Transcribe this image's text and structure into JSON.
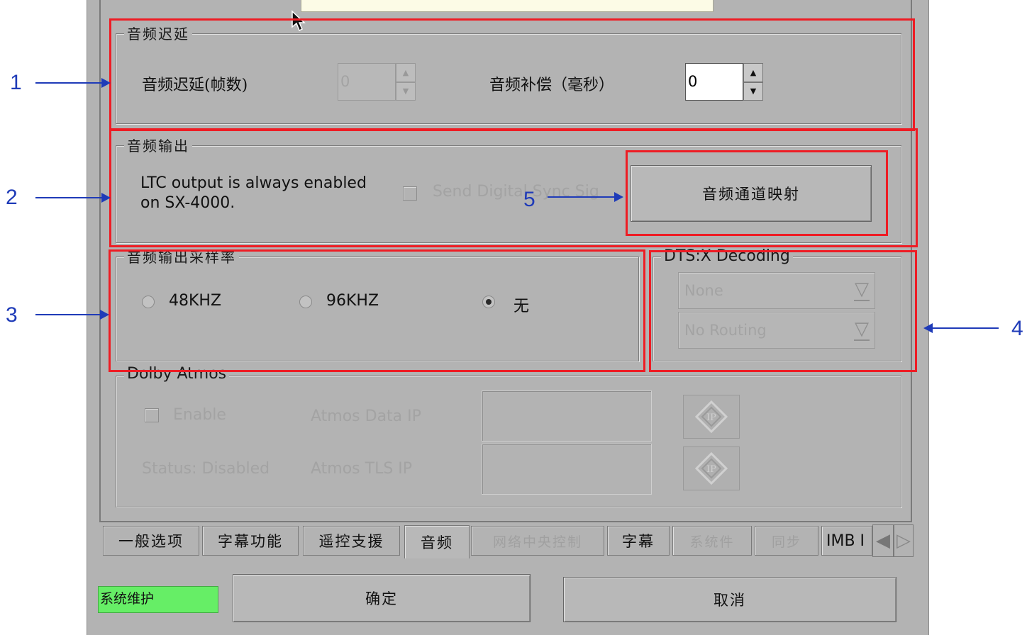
{
  "audio_delay": {
    "title": "音频迟延",
    "frames_label": "音频迟延(帧数)",
    "frames_value": "0",
    "comp_label": "音频补偿（毫秒）",
    "comp_value": "0"
  },
  "audio_output": {
    "title": "音频输出",
    "ltc_line1": "LTC output is always enabled",
    "ltc_line2": "on SX-4000.",
    "send_digital_label": "Send Digital Sync Sig",
    "channel_mapping_button": "音频通道映射"
  },
  "sample_rate": {
    "title": "音频输出采样率",
    "options": [
      "48KHZ",
      "96KHZ",
      "无"
    ],
    "selected": "无"
  },
  "dtsx": {
    "title": "DTS:X Decoding",
    "combo1": "None",
    "combo2": "No Routing"
  },
  "atmos": {
    "title": "Dolby Atmos",
    "enable_label": "Enable",
    "data_ip_label": "Atmos Data IP",
    "status_label": "Status: Disabled",
    "tls_ip_label": "Atmos TLS IP"
  },
  "tabs": [
    "一般选项",
    "字幕功能",
    "遥控支援",
    "音频",
    "网络中央控制",
    "字幕",
    "系统件",
    "同步",
    "IMB I"
  ],
  "active_tab": "音频",
  "footer": {
    "status": "系统维护",
    "ok": "确定",
    "cancel": "取消"
  },
  "annotations": [
    "1",
    "2",
    "3",
    "4",
    "5"
  ],
  "colors": {
    "dialog_bg": "#b3b3b3",
    "annotation_box": "#ee1c24",
    "annotation_arrow": "#1f3bb8",
    "status_bg": "#66ee66"
  }
}
